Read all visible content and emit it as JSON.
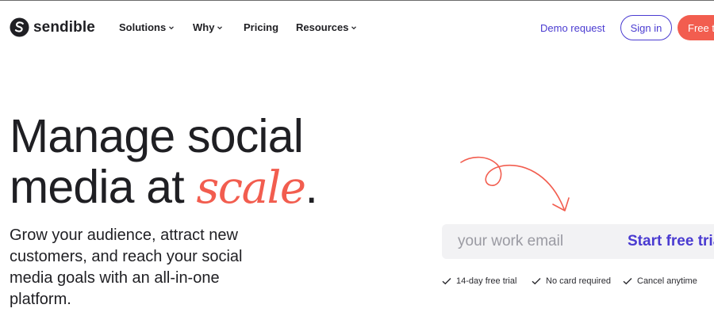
{
  "brand": {
    "name": "sendible",
    "logo_icon": "sendible-logo-icon"
  },
  "nav": {
    "items": [
      {
        "label": "Solutions",
        "has_dropdown": true
      },
      {
        "label": "Why",
        "has_dropdown": true
      },
      {
        "label": "Pricing",
        "has_dropdown": false
      },
      {
        "label": "Resources",
        "has_dropdown": true
      }
    ],
    "demo_label": "Demo request",
    "signin_label": "Sign in",
    "trial_label": "Free trial"
  },
  "hero": {
    "title_line1": "Manage social",
    "title_line2_pre": "media at ",
    "title_accent": "scale",
    "title_end": ".",
    "subtitle": "Grow your audience, attract new customers, and reach your social media goals with an all-in-one platform."
  },
  "signup": {
    "email_placeholder": "your work email",
    "submit_label": "Start free trial"
  },
  "perks": [
    {
      "label": "14-day free trial",
      "icon": "check-icon"
    },
    {
      "label": "No card required",
      "icon": "check-icon"
    },
    {
      "label": "Cancel anytime",
      "icon": "check-icon"
    }
  ],
  "colors": {
    "accent_coral": "#f25d4f",
    "accent_indigo": "#4a3bd1",
    "text_dark": "#1f1f23",
    "input_bg": "#f2f2f4"
  }
}
